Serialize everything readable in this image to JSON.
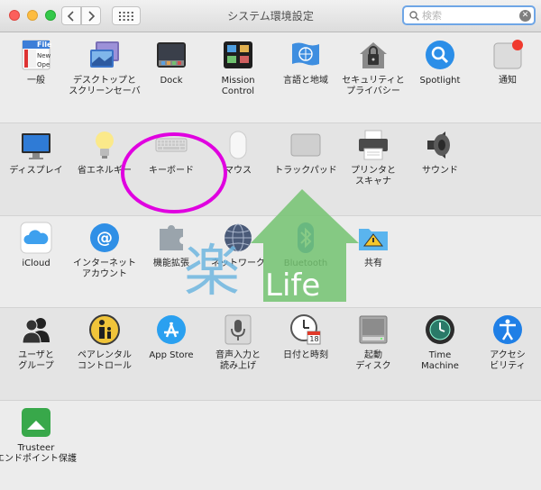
{
  "window": {
    "title": "システム環境設定"
  },
  "search": {
    "placeholder": "検索",
    "value": ""
  },
  "sections": {
    "personal": [
      {
        "label": "一般"
      },
      {
        "label": "デスクトップと\nスクリーンセーバ"
      },
      {
        "label": "Dock"
      },
      {
        "label": "Mission\nControl"
      },
      {
        "label": "言語と地域"
      },
      {
        "label": "セキュリティと\nプライバシー"
      },
      {
        "label": "Spotlight"
      },
      {
        "label": "通知"
      }
    ],
    "hardware": [
      {
        "label": "ディスプレイ"
      },
      {
        "label": "省エネルギー"
      },
      {
        "label": "キーボード"
      },
      {
        "label": "マウス"
      },
      {
        "label": "トラックパッド"
      },
      {
        "label": "プリンタと\nスキャナ"
      },
      {
        "label": "サウンド"
      }
    ],
    "internet": [
      {
        "label": "iCloud"
      },
      {
        "label": "インターネット\nアカウント"
      },
      {
        "label": "機能拡張"
      },
      {
        "label": "ネットワーク"
      },
      {
        "label": "Bluetooth"
      },
      {
        "label": "共有"
      }
    ],
    "system": [
      {
        "label": "ユーザと\nグループ"
      },
      {
        "label": "ペアレンタル\nコントロール"
      },
      {
        "label": "App Store"
      },
      {
        "label": "音声入力と\n読み上げ"
      },
      {
        "label": "日付と時刻"
      },
      {
        "label": "起動\nディスク"
      },
      {
        "label": "Time\nMachine"
      },
      {
        "label": "アクセシ\nビリティ"
      }
    ],
    "other": [
      {
        "label": "Trusteer\nエンドポイント保護"
      }
    ]
  },
  "icons": {
    "general_file_text": "File",
    "general_line2": "New",
    "general_line3": "Ope",
    "calendar_day": "18"
  },
  "watermark": {
    "kanji": "楽",
    "text": "Life"
  },
  "colors": {
    "highlight_ellipse": "#e000e0",
    "watermark_green": "#74c371",
    "watermark_blue": "#6fb6e0"
  }
}
